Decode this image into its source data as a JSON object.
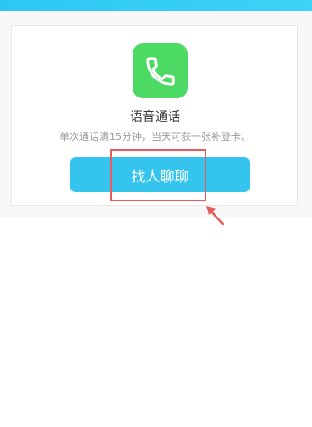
{
  "colors": {
    "top_bar": "#2ec7f3",
    "icon_bg": "#4cd964",
    "button_bg": "#35c4ee",
    "highlight": "#e45c5c"
  },
  "card": {
    "icon_name": "phone-icon",
    "title": "语音通话",
    "description": "单次通话满15分钟，当天可获一张补登卡。",
    "button_label": "找人聊聊"
  },
  "annotation": {
    "highlight_target": "chat-button",
    "arrow_icon": "arrow-up-left-icon"
  }
}
